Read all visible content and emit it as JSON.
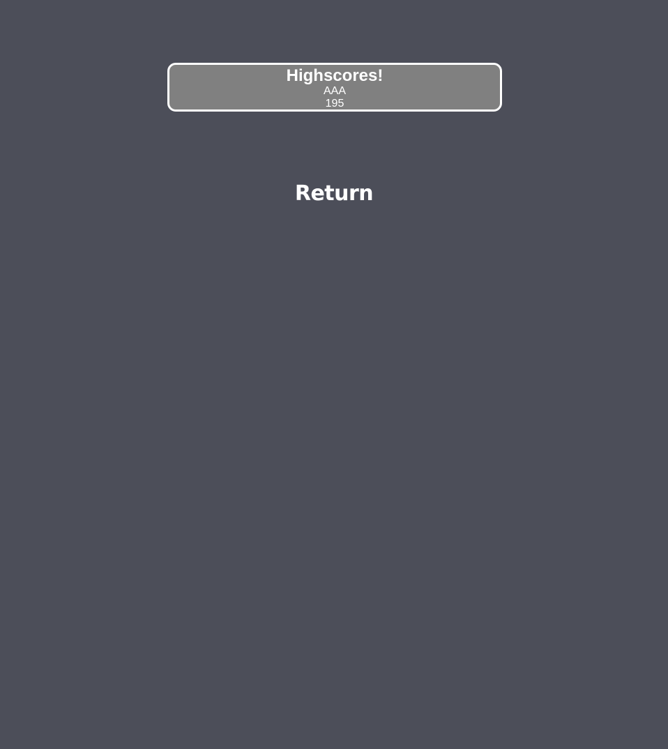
{
  "highscores": {
    "title": "Highscores!",
    "entries": [
      {
        "name": "AAA",
        "score": "195"
      }
    ]
  },
  "return_label": "Return",
  "colors": {
    "background": "#4c4e59",
    "panel": "#808080",
    "border": "#ffffff",
    "text": "#ffffff"
  }
}
